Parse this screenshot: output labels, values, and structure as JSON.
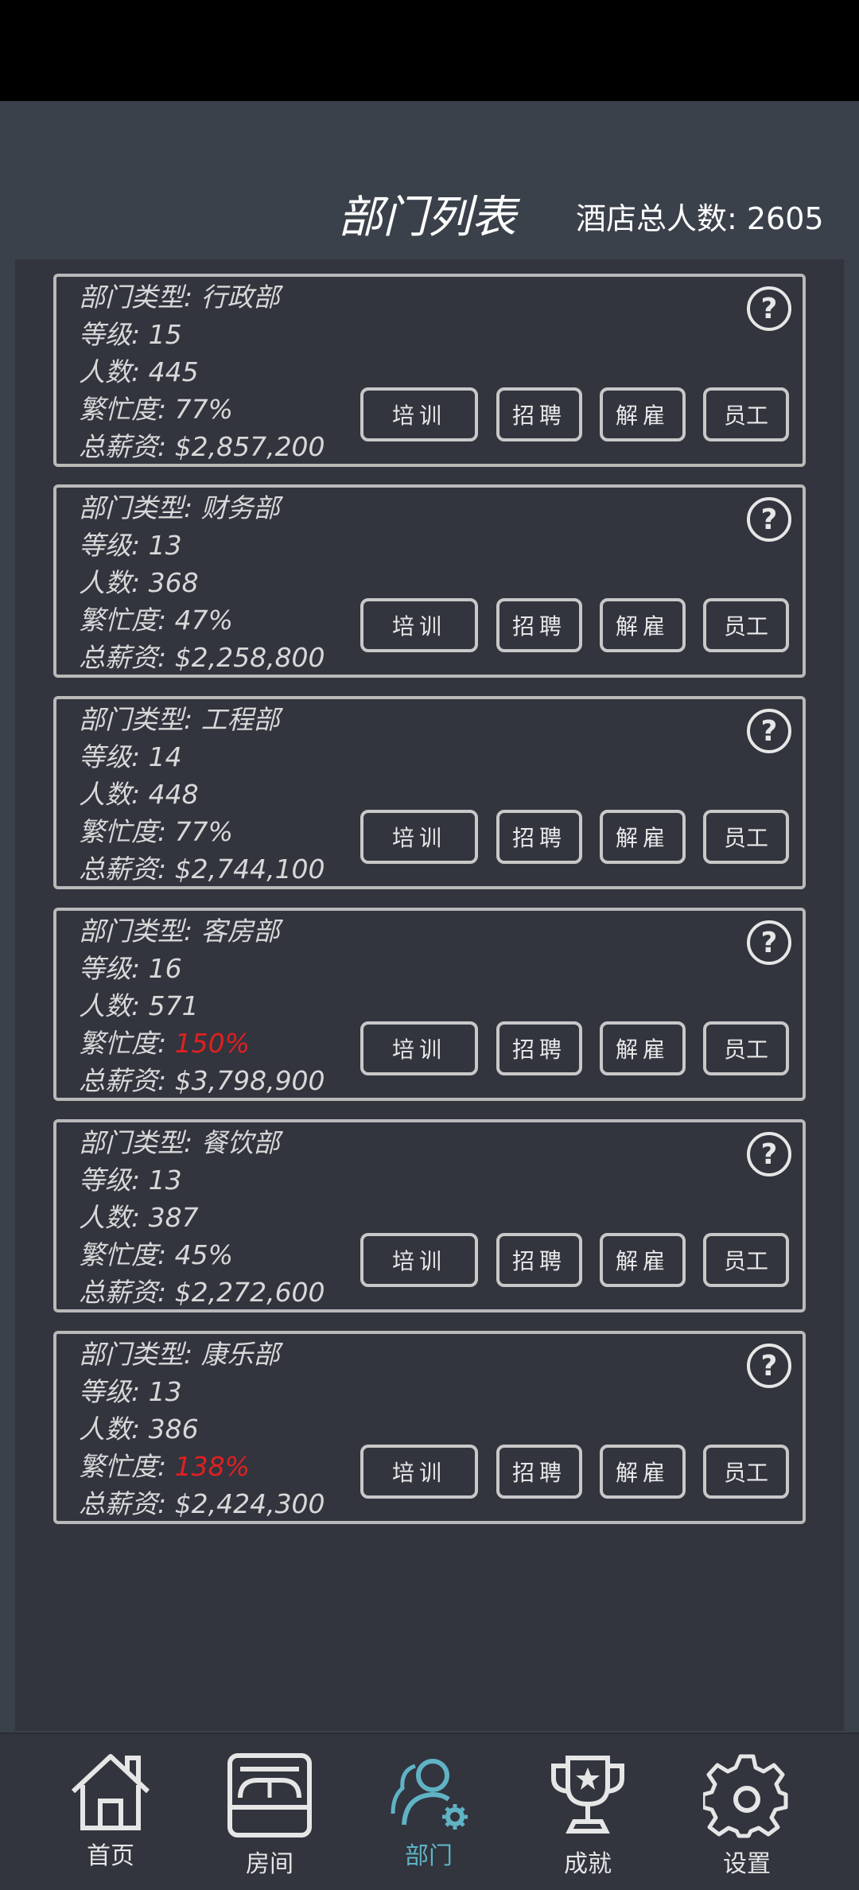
{
  "header": {
    "title": "部门列表",
    "total_staff": "酒店总人数: 2605"
  },
  "buttons": {
    "train": "培训",
    "hire": "招聘",
    "fire": "解雇",
    "staff": "员工"
  },
  "departments": [
    {
      "type": "部门类型: 行政部",
      "level": "等级: 15",
      "count": "人数: 445",
      "busy_label": "繁忙度: ",
      "busy": "77%",
      "overload": false,
      "salary": "总薪资: $2,857,200"
    },
    {
      "type": "部门类型: 财务部",
      "level": "等级: 13",
      "count": "人数: 368",
      "busy_label": "繁忙度: ",
      "busy": "47%",
      "overload": false,
      "salary": "总薪资: $2,258,800"
    },
    {
      "type": "部门类型: 工程部",
      "level": "等级: 14",
      "count": "人数: 448",
      "busy_label": "繁忙度: ",
      "busy": "77%",
      "overload": false,
      "salary": "总薪资: $2,744,100"
    },
    {
      "type": "部门类型: 客房部",
      "level": "等级: 16",
      "count": "人数: 571",
      "busy_label": "繁忙度: ",
      "busy": "150%",
      "overload": true,
      "salary": "总薪资: $3,798,900"
    },
    {
      "type": "部门类型: 餐饮部",
      "level": "等级: 13",
      "count": "人数: 387",
      "busy_label": "繁忙度: ",
      "busy": "45%",
      "overload": false,
      "salary": "总薪资: $2,272,600"
    },
    {
      "type": "部门类型: 康乐部",
      "level": "等级: 13",
      "count": "人数: 386",
      "busy_label": "繁忙度: ",
      "busy": "138%",
      "overload": true,
      "salary": "总薪资: $2,424,300"
    }
  ],
  "nav": {
    "home": "首页",
    "rooms": "房间",
    "departments": "部门",
    "achievements": "成就",
    "settings": "设置"
  },
  "colors": {
    "background": "#3b414b",
    "panel": "#32343e",
    "overload": "#e02020",
    "active_nav": "#5fb3c4"
  }
}
